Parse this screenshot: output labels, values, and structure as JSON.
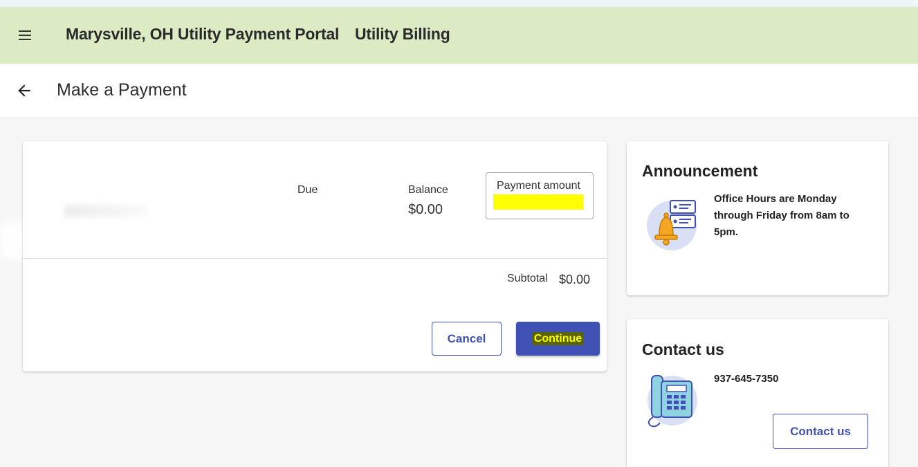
{
  "header": {
    "app_title": "Marysville, OH Utility Payment Portal",
    "app_subtitle": "Utility Billing"
  },
  "page": {
    "title": "Make a Payment"
  },
  "payment": {
    "due_label": "Due",
    "balance_label": "Balance",
    "balance_value": "$0.00",
    "amount_label": "Payment amount",
    "amount_value": "",
    "subtotal_label": "Subtotal",
    "subtotal_value": "$0.00",
    "cancel_label": "Cancel",
    "continue_label": "Continue"
  },
  "announcement": {
    "heading": "Announcement",
    "text": "Office Hours are Monday through Friday from 8am to 5pm."
  },
  "contact": {
    "heading": "Contact us",
    "phone": "937-645-7350",
    "button_label": "Contact us"
  },
  "colors": {
    "header_bg": "#dcebc4",
    "primary": "#3f51b5",
    "highlight": "#ffff00"
  },
  "icons": {
    "menu": "menu-icon",
    "back": "arrow-back-icon",
    "announcement": "bell-notification-icon",
    "phone": "telephone-icon"
  }
}
